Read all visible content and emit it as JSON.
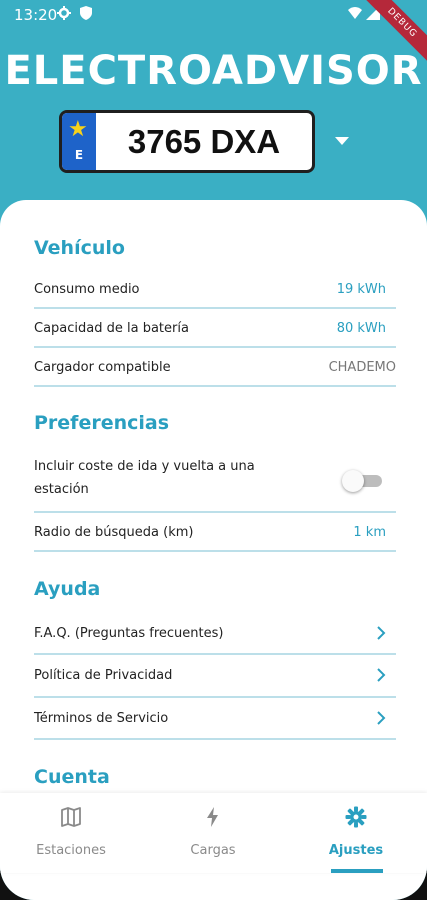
{
  "status_bar": {
    "time": "13:20"
  },
  "debug_banner": "DEBUG",
  "app": {
    "title": "ELECTROADVISOR"
  },
  "plate": {
    "country": "E",
    "number": "3765 DXA"
  },
  "sections": {
    "vehiculo": {
      "title": "Vehículo",
      "rows": [
        {
          "label": "Consumo medio",
          "value": "19 kWh"
        },
        {
          "label": "Capacidad de la batería",
          "value": "80 kWh"
        },
        {
          "label": "Cargador compatible",
          "value": "CHADEMO"
        }
      ]
    },
    "preferencias": {
      "title": "Preferencias",
      "rows": [
        {
          "label_line1": "Incluir coste de ida y vuelta a una",
          "label_line2": "estación",
          "toggle_on": false
        },
        {
          "label": "Radio de búsqueda (km)",
          "value": "1 km"
        }
      ]
    },
    "ayuda": {
      "title": "Ayuda",
      "rows": [
        {
          "label": "F.A.Q. (Preguntas frecuentes)"
        },
        {
          "label": "Política de Privacidad"
        },
        {
          "label": "Términos de Servicio"
        }
      ]
    },
    "cuenta": {
      "title": "Cuenta"
    }
  },
  "nav": {
    "items": [
      {
        "label": "Estaciones",
        "icon": "map-icon"
      },
      {
        "label": "Cargas",
        "icon": "bolt-icon"
      },
      {
        "label": "Ajustes",
        "icon": "gear-icon"
      }
    ],
    "active_index": 2
  },
  "colors": {
    "header_bg": "#3aafc4",
    "accent": "#2a9fc0",
    "divider": "#bcdfe9"
  }
}
